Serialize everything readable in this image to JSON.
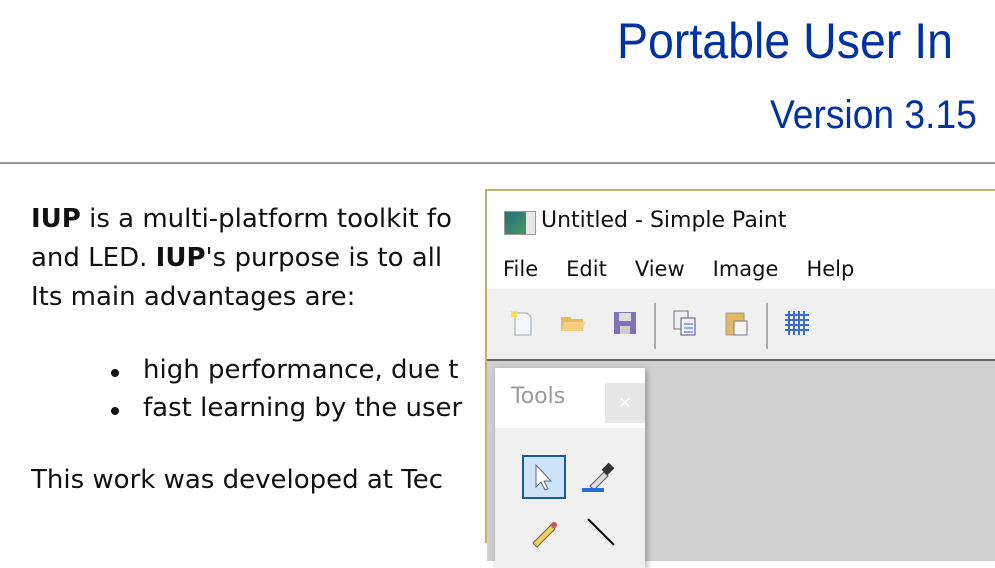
{
  "doc": {
    "title": "Portable User In",
    "version": "Version 3.15",
    "para1_bold": "IUP",
    "para1_rest": " is a multi-platform toolkit fo",
    "para2_a": "and LED. ",
    "para2_bold": "IUP",
    "para2_rest": "'s purpose is to all",
    "para3": "Its main advantages are:",
    "bullets": [
      "high performance, due t",
      "fast learning by the user"
    ],
    "para4": "This work was developed at Tec"
  },
  "window": {
    "title": "Untitled - Simple Paint",
    "menu": [
      "File",
      "Edit",
      "View",
      "Image",
      "Help"
    ],
    "toolbar": [
      "new-file",
      "open-folder",
      "save",
      "copy",
      "paste",
      "grid"
    ],
    "tools_panel": {
      "title": "Tools",
      "close": "×"
    }
  }
}
